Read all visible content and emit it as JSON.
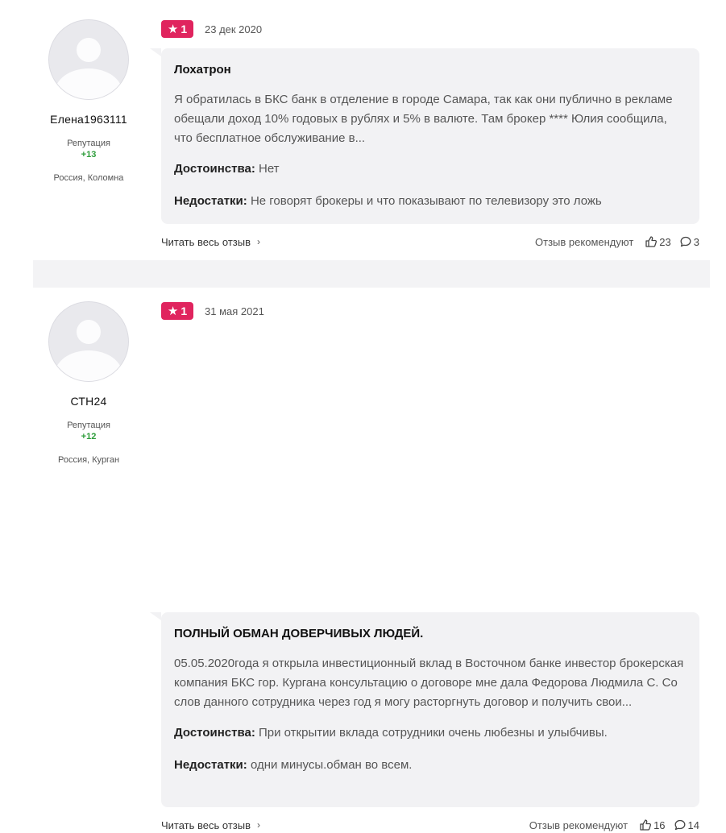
{
  "reviews": [
    {
      "author": {
        "username": "Елена1963111",
        "reputation_label": "Репутация",
        "reputation": "+13",
        "location": "Россия, Коломна"
      },
      "rating": "1",
      "date": "23 дек 2020",
      "title": "Лохатрон",
      "text": "Я обратилась в БКС банк в отделение в городе Самара, так как они публично в рекламе обещали доход 10% годовых в рублях и 5% в валюте. Там брокер **** Юлия сообщила, что бесплатное обслуживание в...",
      "pros_label": "Достоинства:",
      "pros": "Нет",
      "cons_label": "Недостатки:",
      "cons": "Не говорят брокеры и что показывают по телевизору это ложь",
      "read_more": "Читать весь отзыв",
      "recommend": "Отзыв рекомендуют",
      "likes": "23",
      "comments": "3"
    },
    {
      "author": {
        "username": "СТН24",
        "reputation_label": "Репутация",
        "reputation": "+12",
        "location": "Россия, Курган"
      },
      "rating": "1",
      "date": "31 мая 2021",
      "title": "ПОЛНЫЙ ОБМАН ДОВЕРЧИВЫХ ЛЮДЕЙ.",
      "text": "05.05.2020года я открыла инвестиционный вклад в Восточном банке инвестор брокерская компания БКС гор. Кургана консультацию о договоре мне дала Федорова Людмила С. Со слов данного сотрудника через год я могу расторгнуть договор и получить свои...",
      "pros_label": "Достоинства:",
      "pros": "При открытии вклада сотрудники очень любезны и улыбчивы.",
      "cons_label": "Недостатки:",
      "cons": "одни минусы.обман во всем.",
      "read_more": "Читать весь отзыв",
      "recommend": "Отзыв рекомендуют",
      "likes": "16",
      "comments": "14"
    }
  ],
  "colors": {
    "badge": "#e0245e",
    "reputation": "#2e9d3b",
    "card": "#f2f2f4"
  },
  "icons": {
    "rating": "star-icon",
    "more": "chevron-right-icon",
    "likes": "thumbs-up-icon",
    "comments": "comment-icon",
    "avatar": "user-placeholder-icon"
  }
}
